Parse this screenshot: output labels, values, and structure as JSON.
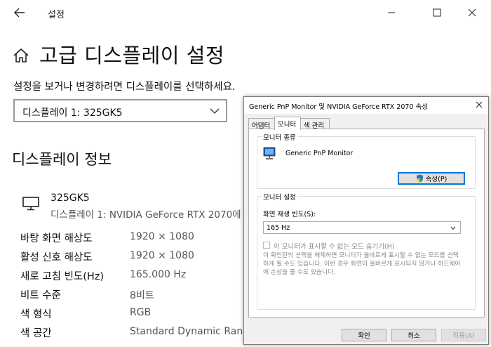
{
  "window": {
    "title": "설정",
    "controls": {
      "minimize": "–",
      "maximize": "☐",
      "close": "✕"
    }
  },
  "page": {
    "title": "고급 디스플레이 설정",
    "subtitle": "설정을 보거나 변경하려면 디스플레이를 선택하세요.",
    "display_select": {
      "value": "디스플레이 1: 325GK5"
    },
    "section_title": "디스플레이 정보",
    "display": {
      "name": "325GK5",
      "description": "디스플레이 1: NVIDIA GeForce RTX 2070에"
    },
    "info": [
      {
        "label": "바탕 화면 해상도",
        "value": "1920 × 1080"
      },
      {
        "label": "활성 신호 해상도",
        "value": "1920 × 1080"
      },
      {
        "label": "새로 고침 빈도(Hz)",
        "value": "165.000 Hz"
      },
      {
        "label": "비트 수준",
        "value": "8비트"
      },
      {
        "label": "색 형식",
        "value": "RGB"
      },
      {
        "label": "색 공간",
        "value": "Standard Dynamic Rang"
      }
    ]
  },
  "dialog": {
    "title": "Generic PnP Monitor 및 NVIDIA GeForce RTX 2070 속성",
    "close": "✕",
    "tabs": [
      "어댑터",
      "모니터",
      "색 관리"
    ],
    "active_tab": "모니터",
    "monitor_type": {
      "legend": "모니터 종류",
      "name": "Generic PnP Monitor",
      "properties_button": "속성(P)"
    },
    "monitor_settings": {
      "legend": "모니터 설정",
      "refresh_label": "화면 재생 빈도(S):",
      "refresh_value": "165 Hz",
      "hide_modes_label": "이 모니터가 표시할 수 없는 모드 숨기기(H)",
      "hide_modes_checked": false,
      "note": "이 확인란의 선택을 해제하면 모니터가 올바르게 표시할 수 없는 모드를 선택하게 될 수도 있습니다. 이런 경우 화면이 올바르게 표시되지 않거나 하드웨어에 손상을 줄 수도 있습니다."
    },
    "buttons": {
      "ok": "확인",
      "cancel": "취소",
      "apply": "적용(A)"
    }
  },
  "colors": {
    "accent": "#0078d7",
    "dialog_bg": "#f0f0f0",
    "button_bg": "#e1e1e1"
  }
}
